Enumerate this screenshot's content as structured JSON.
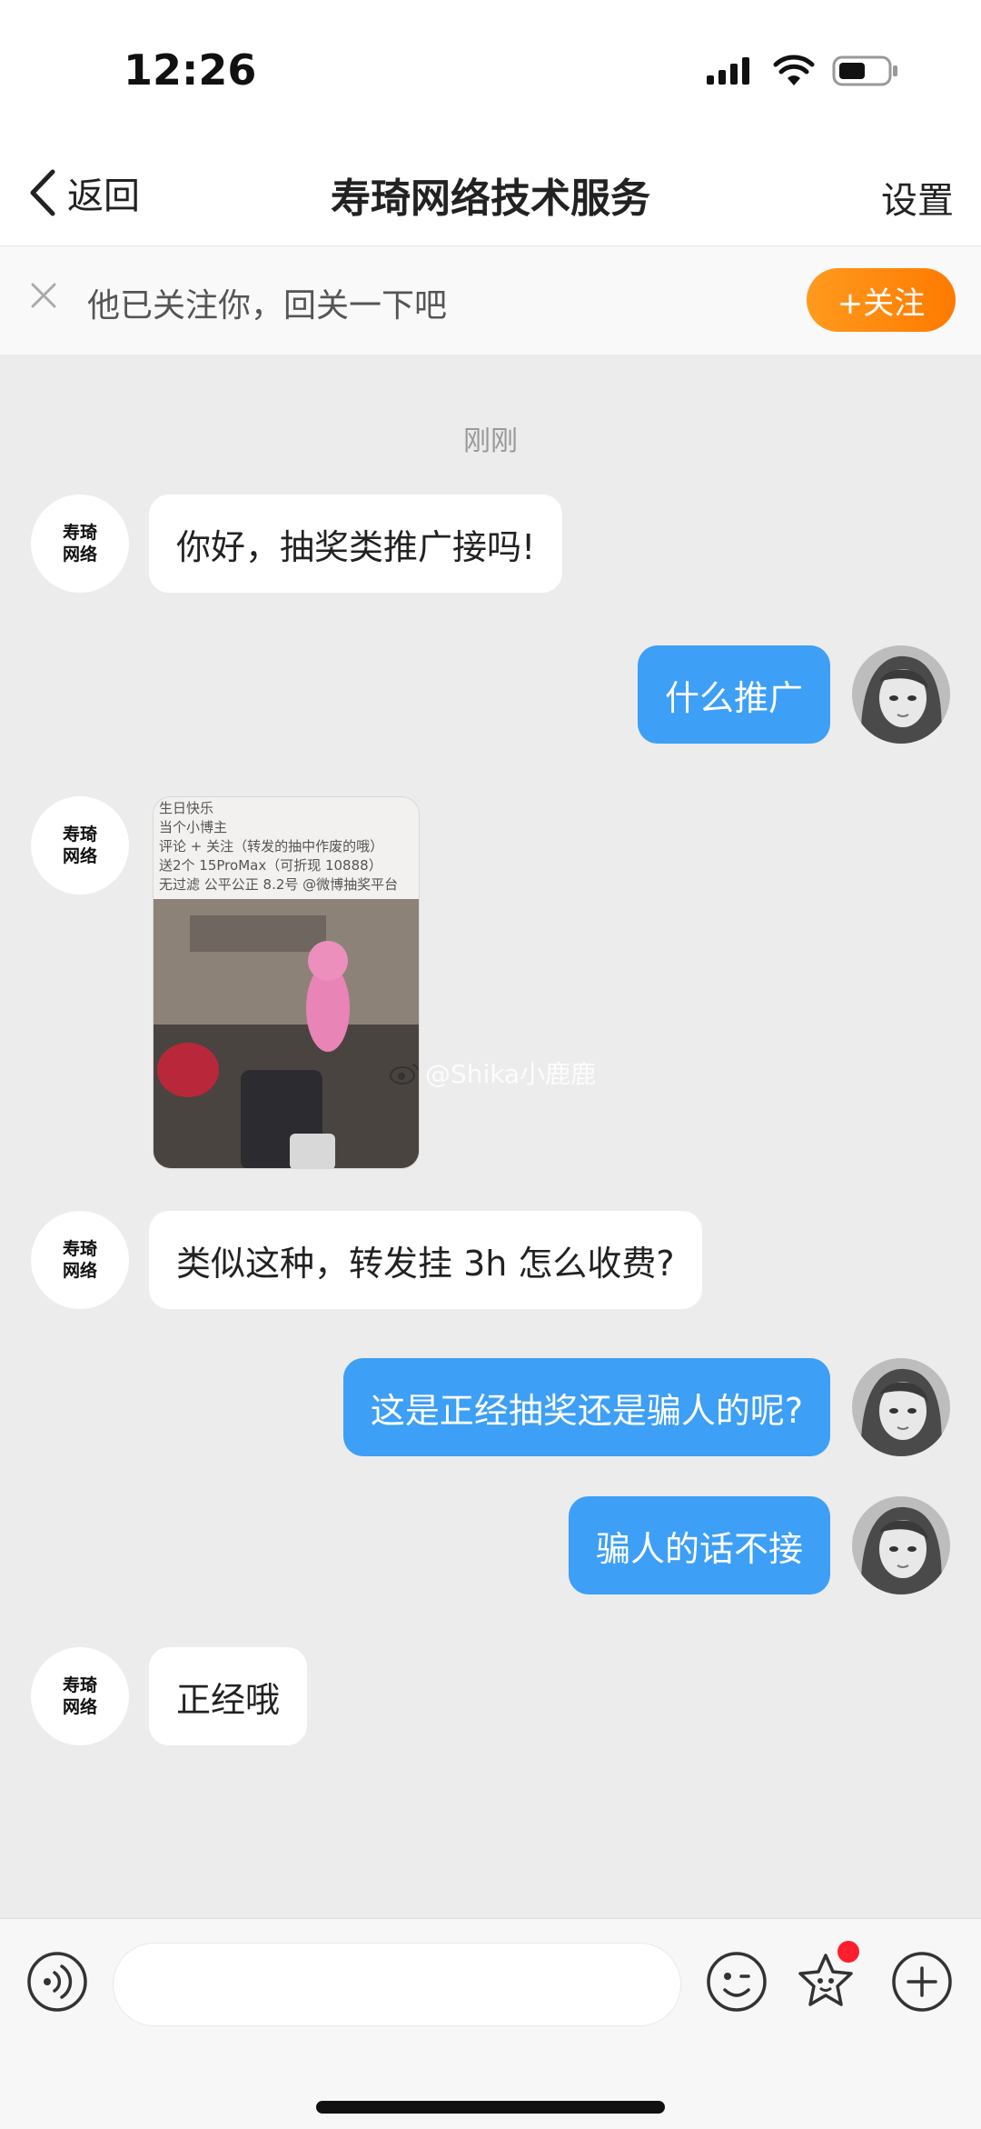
{
  "status_bar": {
    "time": "12:26"
  },
  "nav": {
    "back_label": "返回",
    "title": "寿琦网络技术服务",
    "settings_label": "设置"
  },
  "follow_prompt": {
    "text": "他已关注你，回关一下吧",
    "button_label": "+关注"
  },
  "chat": {
    "time_label": "刚刚",
    "contact_avatar_text": [
      "寿琦",
      "网络"
    ],
    "messages": [
      {
        "side": "in",
        "type": "text",
        "text": "你好，抽奖类推广接吗!"
      },
      {
        "side": "out",
        "type": "text",
        "text": "什么推广"
      },
      {
        "side": "in",
        "type": "image",
        "image_lines": [
          "生日快乐",
          "当个小博主",
          "评论 + 关注（转发的抽中作废的哦）",
          "送2个 15ProMax（可折现 10888）",
          "无过滤 公平公正 8.2号 @微博抽奖平台"
        ],
        "watermark": "@Shika小鹿鹿"
      },
      {
        "side": "in",
        "type": "text",
        "text": "类似这种，转发挂 3h 怎么收费?"
      },
      {
        "side": "out",
        "type": "text",
        "text": "这是正经抽奖还是骗人的呢?"
      },
      {
        "side": "out",
        "type": "text",
        "text": "骗人的话不接"
      },
      {
        "side": "in",
        "type": "text",
        "text": "正经哦"
      }
    ]
  },
  "input_bar": {
    "placeholder": "",
    "icons": [
      "voice-icon",
      "emoji-icon",
      "sticker-icon",
      "plus-icon"
    ]
  },
  "colors": {
    "outgoing_bubble": "#3d9ff5",
    "follow_button": "#ff8a00",
    "background": "#ececec"
  }
}
